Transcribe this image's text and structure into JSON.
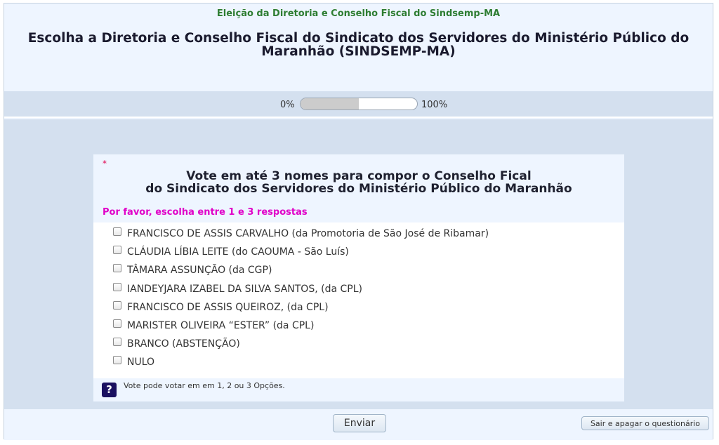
{
  "header": {
    "group_title": "Eleição da Diretoria e Conselho Fiscal do Sindsemp-MA",
    "survey_title": "Escolha a Diretoria e Conselho Fiscal do Sindicato dos Servidores do Ministério Público do Maranhão (SINDSEMP-MA)"
  },
  "progress": {
    "left_label": "0%",
    "right_label": "100%",
    "value_fraction": 0.5
  },
  "question": {
    "mandatory_marker": "*",
    "text_line1": "Vote em até 3 nomes para compor o Conselho Fical",
    "text_line2": "do Sindicato dos Servidores do Ministério Público do Maranhão",
    "help": "Por favor, escolha entre 1 e 3 respostas",
    "options": [
      "FRANCISCO DE ASSIS CARVALHO (da Promotoria de São José de Ribamar)",
      "CLÁUDIA LÍBIA LEITE (do CAOUMA - São Luís)",
      "TÂMARA ASSUNÇÃO (da CGP)",
      "IANDEYJARA IZABEL DA SILVA SANTOS, (da CPL)",
      "FRANCISCO DE ASSIS QUEIROZ, (da CPL)",
      "MARISTER OLIVEIRA “ESTER” (da CPL)",
      "BRANCO (ABSTENÇÃO)",
      "NULO"
    ],
    "note_icon": "?",
    "note": "Vote pode votar em em 1, 2 ou 3 Opções."
  },
  "footer": {
    "submit_label": "Enviar",
    "clear_label": "Sair e apagar o questionário"
  },
  "colors": {
    "group_title": "#2e7d32",
    "help_text": "#e000c8",
    "mandatory": "#e0004d",
    "band": "#d4e0ef",
    "panel": "#eef5ff"
  }
}
